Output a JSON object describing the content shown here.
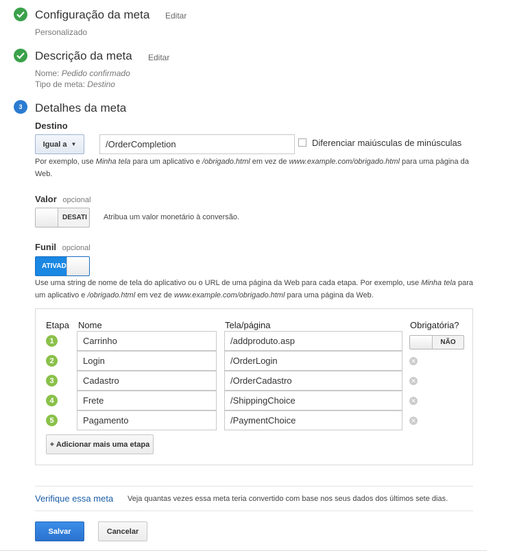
{
  "steps": [
    {
      "title": "Configuração da meta",
      "edit": "Editar",
      "subtitle": "Personalizado"
    },
    {
      "title": "Descrição da meta",
      "edit": "Editar",
      "name_label": "Nome:",
      "name_value": "Pedido confirmado",
      "type_label": "Tipo de meta:",
      "type_value": "Destino"
    },
    {
      "number": "3",
      "title": "Detalhes da meta"
    }
  ],
  "destination": {
    "label": "Destino",
    "match_type": "Igual a",
    "url_value": "/OrderCompletion",
    "case_label": "Diferenciar maiúsculas de minúsculas",
    "help_1": "Por exemplo, use ",
    "help_2": "Minha tela",
    "help_3": " para um aplicativo e ",
    "help_4": "/obrigado.html",
    "help_5": " em vez de ",
    "help_6": "www.example.com/obrigado.html",
    "help_7": " para uma página da",
    "help_8": "Web."
  },
  "value": {
    "label": "Valor",
    "optional": "opcional",
    "toggle_text": "DESATI",
    "description": "Atribua um valor monetário à conversão."
  },
  "funnel": {
    "label": "Funil",
    "optional": "opcional",
    "toggle_text": "ATIVAD",
    "help_1": "Use uma string de nome de tela do aplicativo ou o URL de uma página da Web para cada etapa. Por exemplo, use ",
    "help_2": "Minha tela",
    "help_3": " para",
    "help_4": "um aplicativo e ",
    "help_5": "/obrigado.html",
    "help_6": " em vez de ",
    "help_7": "www.example.com/obrigado.html",
    "help_8": " para uma página da Web."
  },
  "table": {
    "headers": {
      "step": "Etapa",
      "name": "Nome",
      "page": "Tela/página",
      "required": "Obrigatória?"
    },
    "rows": [
      {
        "num": "1",
        "name": "Carrinho",
        "page": "/addproduto.asp"
      },
      {
        "num": "2",
        "name": "Login",
        "page": "/OrderLogin"
      },
      {
        "num": "3",
        "name": "Cadastro",
        "page": "/OrderCadastro"
      },
      {
        "num": "4",
        "name": "Frete",
        "page": "/ShippingChoice"
      },
      {
        "num": "5",
        "name": "Pagamento",
        "page": "/PaymentChoice"
      }
    ],
    "required_toggle": "NÃO",
    "add_step": "+ Adicionar mais uma etapa"
  },
  "verify": {
    "link": "Verifique essa meta",
    "text": "Veja quantas vezes essa meta teria convertido com base nos seus dados dos últimos sete dias."
  },
  "actions": {
    "save": "Salvar",
    "cancel": "Cancelar"
  },
  "colors": {
    "primary": "#2b7bd1",
    "success": "#3aa14a",
    "step_number": "#8ac14a"
  }
}
